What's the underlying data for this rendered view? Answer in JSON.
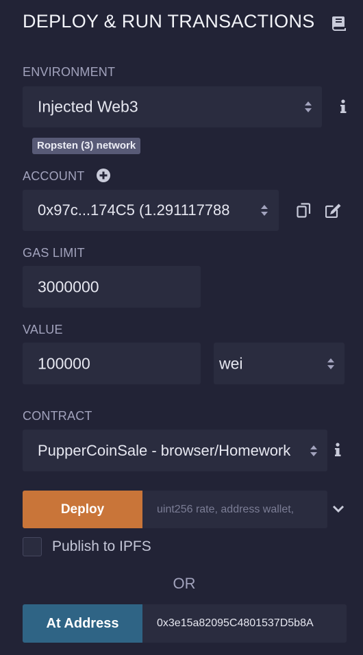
{
  "header": {
    "title": "DEPLOY & RUN TRANSACTIONS",
    "icon": "book-icon"
  },
  "environment": {
    "label": "ENVIRONMENT",
    "selected": "Injected Web3",
    "network_badge": "Ropsten (3) network"
  },
  "account": {
    "label": "ACCOUNT",
    "selected": "0x97c...174C5 (1.291117788",
    "icons": [
      "plus-circle-icon",
      "copy-icon",
      "edit-icon"
    ]
  },
  "gas_limit": {
    "label": "GAS LIMIT",
    "value": "3000000"
  },
  "value": {
    "label": "VALUE",
    "amount": "100000",
    "unit": "wei"
  },
  "contract": {
    "label": "CONTRACT",
    "selected": "PupperCoinSale - browser/Homework"
  },
  "deploy": {
    "button_label": "Deploy",
    "params_placeholder": "uint256 rate, address wallet,"
  },
  "publish": {
    "label": "Publish to IPFS",
    "checked": false
  },
  "divider_text": "OR",
  "at_address": {
    "button_label": "At Address",
    "value": "0x3e15a82095C4801537D5b8A"
  },
  "colors": {
    "background": "#222336",
    "input_bg": "#2a2c3f",
    "deploy_button": "#c97539",
    "at_address_button": "#2f6485",
    "badge": "#585a76"
  }
}
